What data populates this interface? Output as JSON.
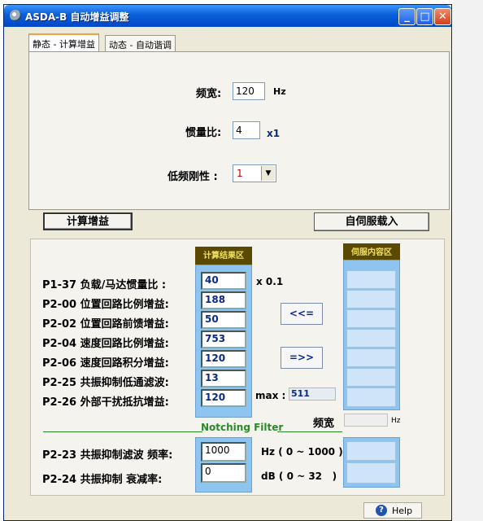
{
  "window": {
    "title": "ASDA-B 自动增益调整",
    "min_label": "_",
    "max_label": "□",
    "close_label": "✕"
  },
  "tabs": [
    {
      "label": "静态 - 计算增益",
      "active": true
    },
    {
      "label": "动态 - 自动谐调",
      "active": false
    }
  ],
  "static_panel": {
    "bandwidth_label": "频宽:",
    "bandwidth_value": "120",
    "bandwidth_unit": "Hz",
    "inertia_label": "惯量比:",
    "inertia_value": "4",
    "inertia_unit": "x1",
    "stiffness_label": "低频刚性 :",
    "stiffness_value": "1"
  },
  "buttons": {
    "calc_gain": "计算增益",
    "load_from_servo": "自伺服载入",
    "copy_left": "<<=",
    "copy_right": "=>>",
    "help": "Help"
  },
  "results": {
    "calc_header": "计算结果区",
    "servo_header": "伺服内容区",
    "rows": [
      {
        "label": "P1-37 负载/马达惯量比 :",
        "value": "40"
      },
      {
        "label": "P2-00 位置回路比例增益:",
        "value": "188"
      },
      {
        "label": "P2-02 位置回路前馈增益:",
        "value": "50"
      },
      {
        "label": "P2-04 速度回路比例增益:",
        "value": "753"
      },
      {
        "label": "P2-06 速度回路积分增益:",
        "value": "120"
      },
      {
        "label": "P2-25 共振抑制低通滤波:",
        "value": "13"
      },
      {
        "label": "P2-26 外部干扰抵抗增益:",
        "value": "120"
      }
    ],
    "inertia_unit": "x 0.1",
    "max_label": "max :",
    "max_value": "511",
    "bandwidth_label": "频宽",
    "bandwidth_unit": "Hz"
  },
  "notching": {
    "title": "Notching Filter",
    "rows": [
      {
        "label": "P2-23 共振抑制滤波 频率:",
        "value": "1000",
        "range": "Hz ( 0 ~ 1000 )"
      },
      {
        "label": "P2-24 共振抑制   衰减率:",
        "value": "0",
        "range": "dB ( 0 ~ 32   )"
      }
    ]
  },
  "colors": {
    "title_bar": "#0a5fd8",
    "panel_bg": "#ece9d8",
    "calc_col": "#8ec4f0",
    "header_bg": "#5a4a00",
    "header_text": "#f0e060",
    "notch_line": "#2a8a2a",
    "value_text": "#0a2a8a"
  }
}
